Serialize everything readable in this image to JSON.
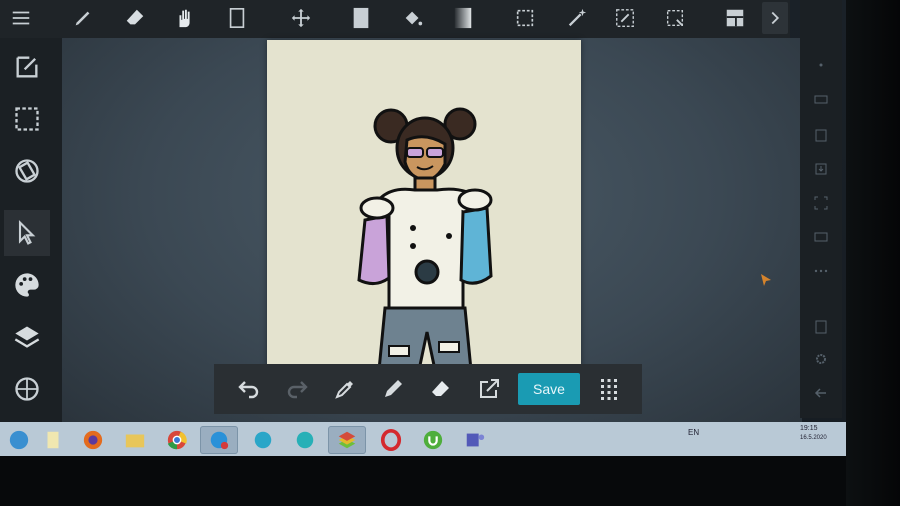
{
  "bottom_toolbar": {
    "save_label": "Save"
  },
  "taskbar": {
    "tray_lang": "EN",
    "time": "19:15",
    "date": "16.5.2020"
  },
  "colors": {
    "accent": "#1a9bb3",
    "toolbar_bg": "#1f2428",
    "paper": "#e4e3cf",
    "sleeve_left": "#c9a3d9",
    "sleeve_right": "#5fb4d6"
  }
}
